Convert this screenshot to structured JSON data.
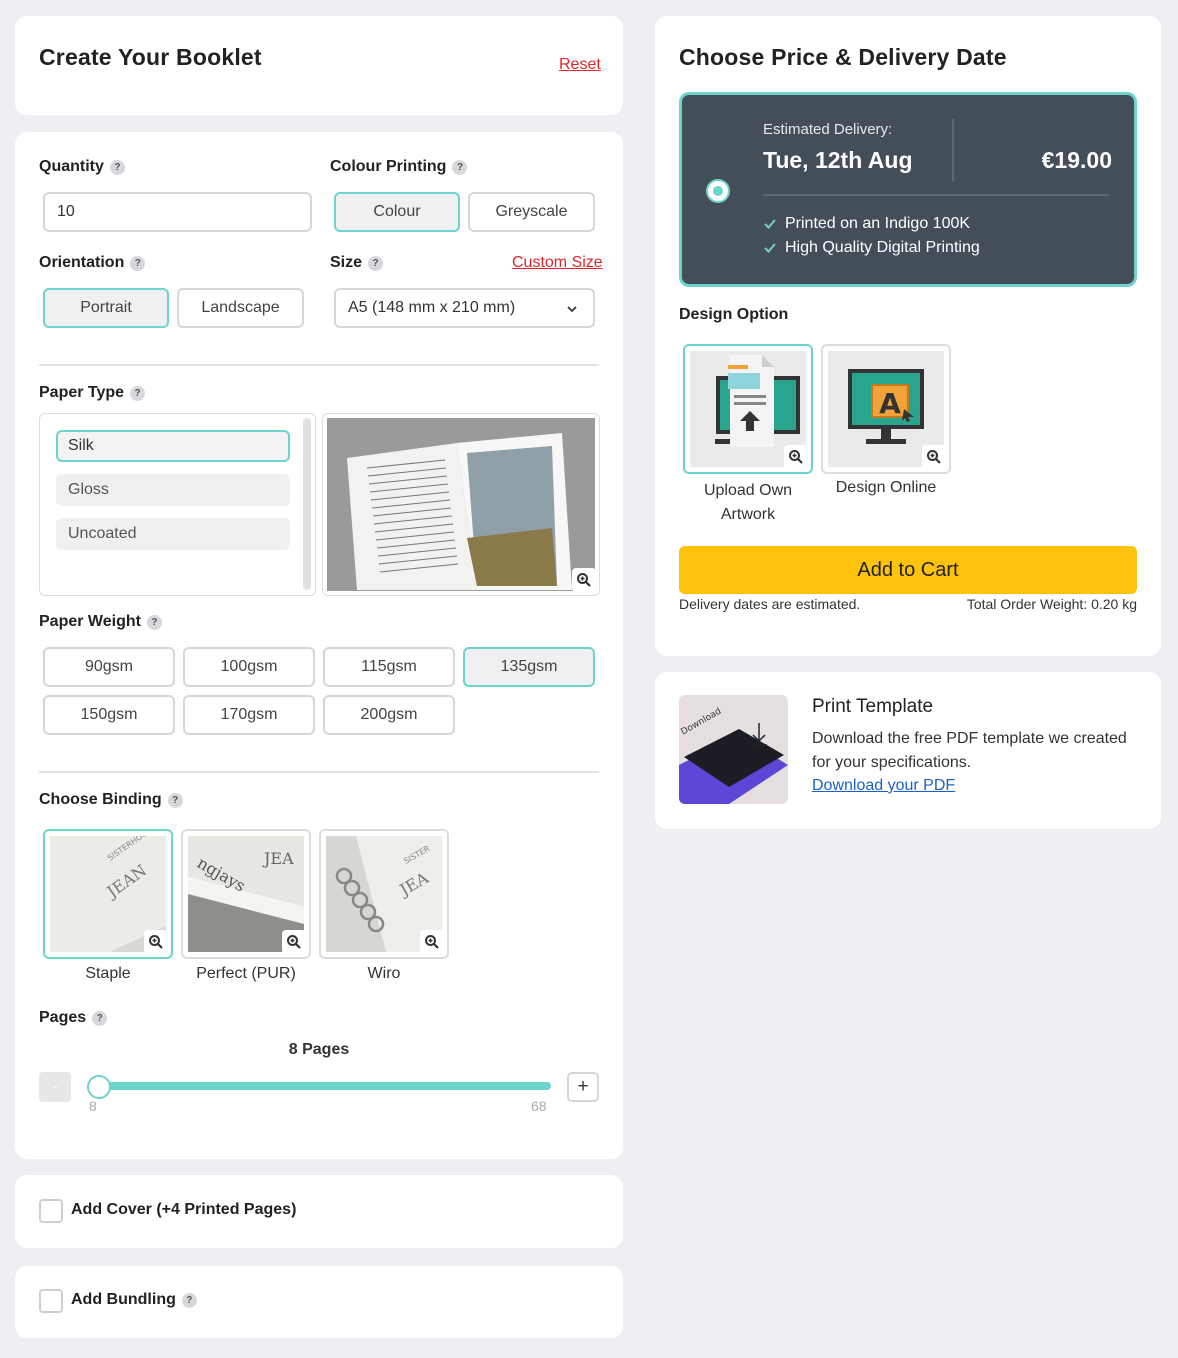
{
  "booklet": {
    "title": "Create Your Booklet",
    "reset": "Reset"
  },
  "quantity": {
    "label": "Quantity",
    "value": "10"
  },
  "colour_printing": {
    "label": "Colour Printing",
    "options": [
      "Colour",
      "Greyscale"
    ],
    "selected": "Colour"
  },
  "orientation": {
    "label": "Orientation",
    "options": [
      "Portrait",
      "Landscape"
    ],
    "selected": "Portrait"
  },
  "size": {
    "label": "Size",
    "custom_link": "Custom Size",
    "value": "A5 (148 mm x 210 mm)"
  },
  "paper_type": {
    "label": "Paper Type",
    "options": [
      "Silk",
      "Gloss",
      "Uncoated"
    ],
    "selected": "Silk"
  },
  "paper_weight": {
    "label": "Paper Weight",
    "options": [
      "90gsm",
      "100gsm",
      "115gsm",
      "135gsm",
      "150gsm",
      "170gsm",
      "200gsm"
    ],
    "selected": "135gsm"
  },
  "binding": {
    "label": "Choose Binding",
    "options": [
      "Staple",
      "Perfect (PUR)",
      "Wiro"
    ],
    "selected": "Staple"
  },
  "pages": {
    "label": "Pages",
    "current": "8 Pages",
    "min": "8",
    "max": "68",
    "minus": "-",
    "plus": "+",
    "value": 8,
    "min_value": 8,
    "max_value": 68
  },
  "add_cover": {
    "label": "Add Cover (+4 Printed Pages)"
  },
  "add_bundling": {
    "label": "Add Bundling"
  },
  "delivery": {
    "title": "Choose Price & Delivery Date",
    "estimated_label": "Estimated Delivery:",
    "date": "Tue, 12th Aug",
    "price": "€19.00",
    "features": [
      "Printed on an Indigo 100K",
      "High Quality Digital Printing"
    ]
  },
  "design": {
    "label": "Design Option",
    "options": [
      "Upload Own Artwork",
      "Design Online"
    ],
    "selected": "Upload Own Artwork"
  },
  "cart": {
    "button": "Add to Cart",
    "note": "Delivery dates are estimated.",
    "weight": "Total Order Weight: 0.20 kg"
  },
  "template": {
    "title": "Print Template",
    "description": "Download the free PDF template we created for your specifications.",
    "link": "Download your PDF",
    "image_text": "Download"
  },
  "colors": {
    "accent": "#6ed3cb",
    "delivery_bg": "#444e59",
    "cart_yellow": "#fcc30a",
    "link_red": "#e0262b",
    "link_blue": "#1a63c6"
  }
}
